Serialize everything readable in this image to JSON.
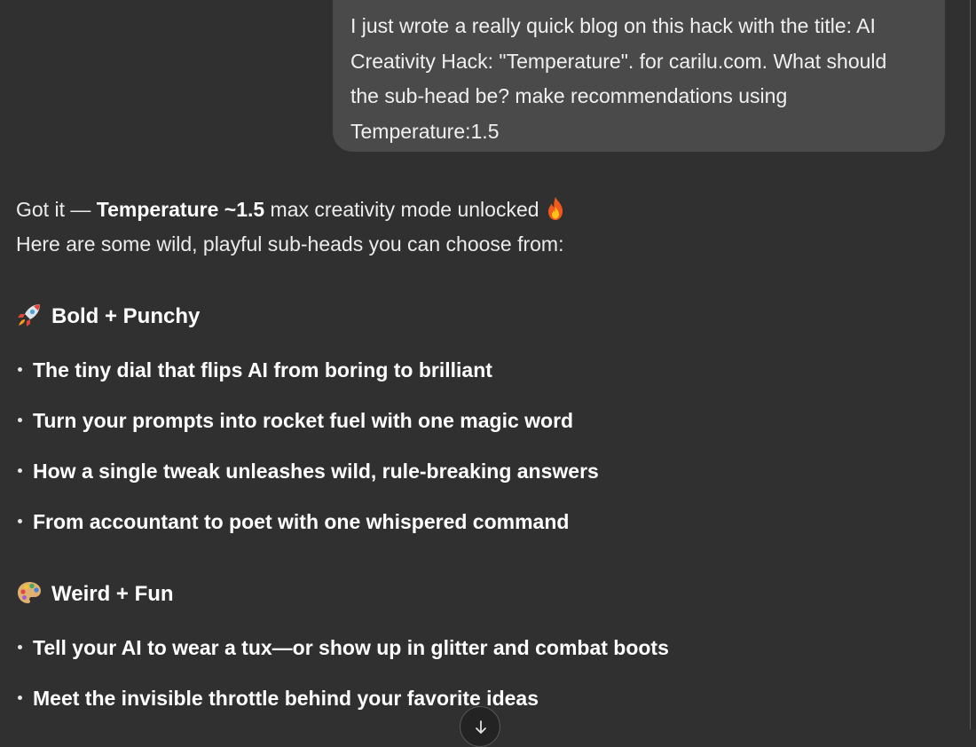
{
  "user_message": {
    "lines": [
      "I just wrote a really quick blog on this hack with the title: AI",
      "Creativity Hack: \"Temperature\". for carilu.com. What should",
      "the sub-head be? make recommendations using",
      "Temperature:1.5"
    ]
  },
  "assistant": {
    "intro_prefix": "Got it — ",
    "intro_bold": "Temperature ~1.5",
    "intro_suffix": " max creativity mode unlocked",
    "intro_emoji": "fire-icon",
    "intro_line2": "Here are some wild, playful sub-heads you can choose from:",
    "sections": [
      {
        "icon": "rocket-icon",
        "title": "Bold + Punchy",
        "items": [
          "The tiny dial that flips AI from boring to brilliant",
          "Turn your prompts into rocket fuel with one magic word",
          "How a single tweak unleashes wild, rule-breaking answers",
          "From accountant to poet with one whispered command"
        ]
      },
      {
        "icon": "palette-icon",
        "title": "Weird + Fun",
        "items": [
          "Tell your AI to wear a tux—or show up in glitter and combat boots",
          "Meet the invisible throttle behind your favorite ideas"
        ]
      }
    ]
  },
  "controls": {
    "scroll_button_icon": "arrow-down-icon"
  }
}
